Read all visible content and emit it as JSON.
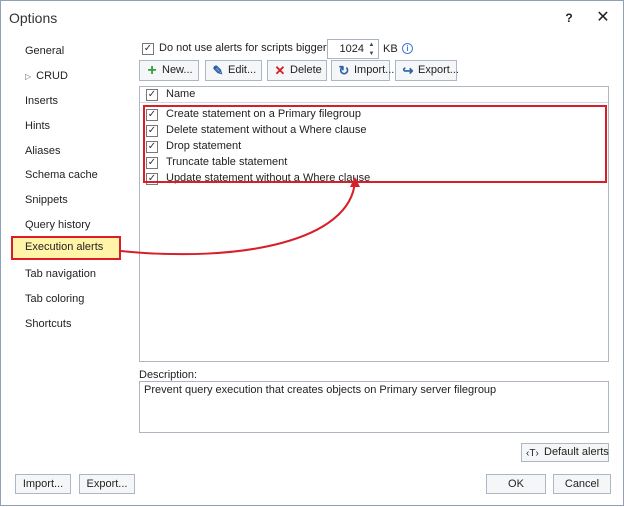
{
  "window": {
    "title": "Options",
    "help": "?",
    "close": "✕"
  },
  "sidebar": {
    "items": [
      {
        "label": "General",
        "caret": ""
      },
      {
        "label": "CRUD",
        "caret": "▷"
      },
      {
        "label": "Inserts",
        "caret": ""
      },
      {
        "label": "Hints",
        "caret": ""
      },
      {
        "label": "Aliases",
        "caret": ""
      },
      {
        "label": "Schema cache",
        "caret": ""
      },
      {
        "label": "Snippets",
        "caret": ""
      },
      {
        "label": "Query history",
        "caret": ""
      },
      {
        "label": "Execution alerts",
        "caret": ""
      },
      {
        "label": "Tab navigation",
        "caret": ""
      },
      {
        "label": "Tab coloring",
        "caret": ""
      },
      {
        "label": "Shortcuts",
        "caret": ""
      }
    ],
    "active": "Execution alerts"
  },
  "alerts_option": {
    "checked": true,
    "label": "Do not use alerts for scripts bigger than",
    "value": "1024",
    "unit": "KB"
  },
  "toolbar": {
    "new": "New...",
    "edit": "Edit...",
    "delete": "Delete",
    "import": "Import...",
    "export": "Export..."
  },
  "grid": {
    "header": "Name",
    "rows": [
      "Create statement on a Primary filegroup",
      "Delete statement without a Where clause",
      "Drop statement",
      "Truncate table statement",
      "Update statement without a Where clause"
    ]
  },
  "description": {
    "label": "Description:",
    "text": "Prevent query execution that creates objects on Primary server filegroup"
  },
  "default_alerts": "Default alerts",
  "footer": {
    "import": "Import...",
    "export": "Export...",
    "ok": "OK",
    "cancel": "Cancel"
  },
  "colors": {
    "accent_red": "#d81e28",
    "highlight_yellow": "#fff4a8",
    "new_icon_green": "#2e9e3e",
    "delete_icon_red": "#d02020",
    "edit_icon_blue": "#2a5fa8"
  }
}
